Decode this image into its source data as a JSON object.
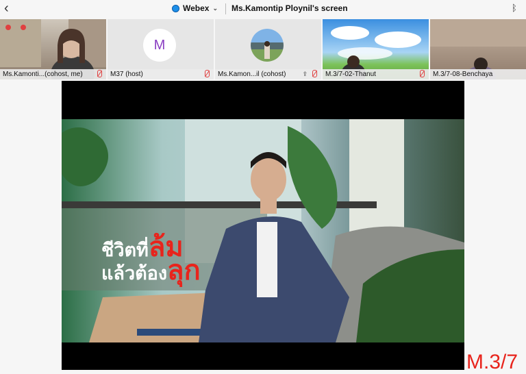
{
  "topbar": {
    "back_icon": "chevron-left-icon",
    "app_name": "Webex",
    "title": "Ms.Kamontip Ploynil's screen",
    "bluetooth_icon": "bluetooth-icon"
  },
  "participants": [
    {
      "name": "Ms.Kamonti...(cohost, me)",
      "muted": true
    },
    {
      "name": "M37 (host)",
      "initial": "M",
      "muted": true
    },
    {
      "name": "Ms.Kamon...il (cohost)",
      "muted": true,
      "sharing": true
    },
    {
      "name": "M.3/7-02-Thanut",
      "muted": true
    },
    {
      "name": "M.3/7-08-Benchaya",
      "muted": false
    }
  ],
  "video": {
    "caption_line1_white": "ชีวิตที่",
    "caption_line1_red": "ล้ม",
    "caption_line2_white": "แล้วต้อง",
    "caption_line2_red": "ลุก"
  },
  "watermark": "M.3/7",
  "colors": {
    "accent": "#1d8fe8",
    "muted": "#e04040",
    "caption_red": "#e8241c"
  }
}
